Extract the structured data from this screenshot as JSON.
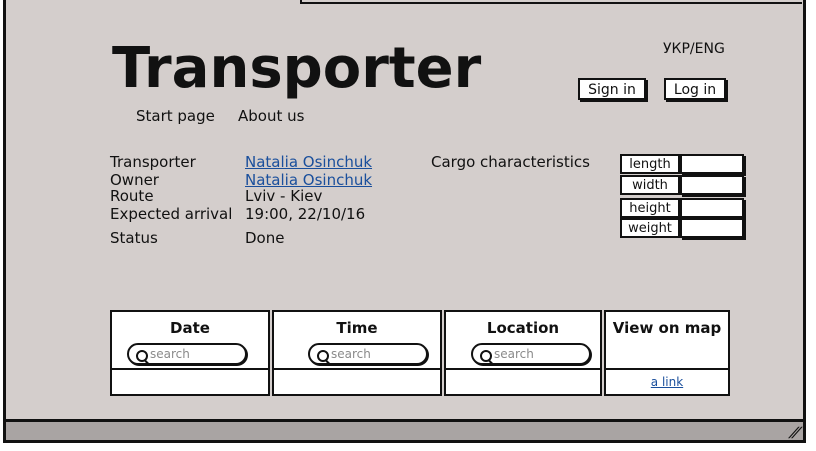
{
  "app": {
    "title": "Transporter",
    "language_toggle": "УКР/ENG"
  },
  "auth": {
    "sign_in": "Sign in",
    "log_in": "Log in"
  },
  "nav": {
    "start_page": "Start page",
    "about_us": "About us"
  },
  "details": {
    "transporter_label": "Transporter",
    "transporter_value": "Natalia Osinchuk",
    "owner_label": "Owner",
    "owner_value": "Natalia Osinchuk",
    "route_label": "Route",
    "route_value": "Lviv - Kiev",
    "arrival_label": "Expected arrival",
    "arrival_value": "19:00, 22/10/16",
    "status_label": "Status",
    "status_value": "Done"
  },
  "cargo": {
    "title": "Cargo characteristics",
    "fields": [
      "length",
      "width",
      "height",
      "weight"
    ]
  },
  "tracking_table": {
    "columns": [
      "Date",
      "Time",
      "Location",
      "View on map"
    ],
    "search_placeholder": "search",
    "map_link": "a link"
  }
}
